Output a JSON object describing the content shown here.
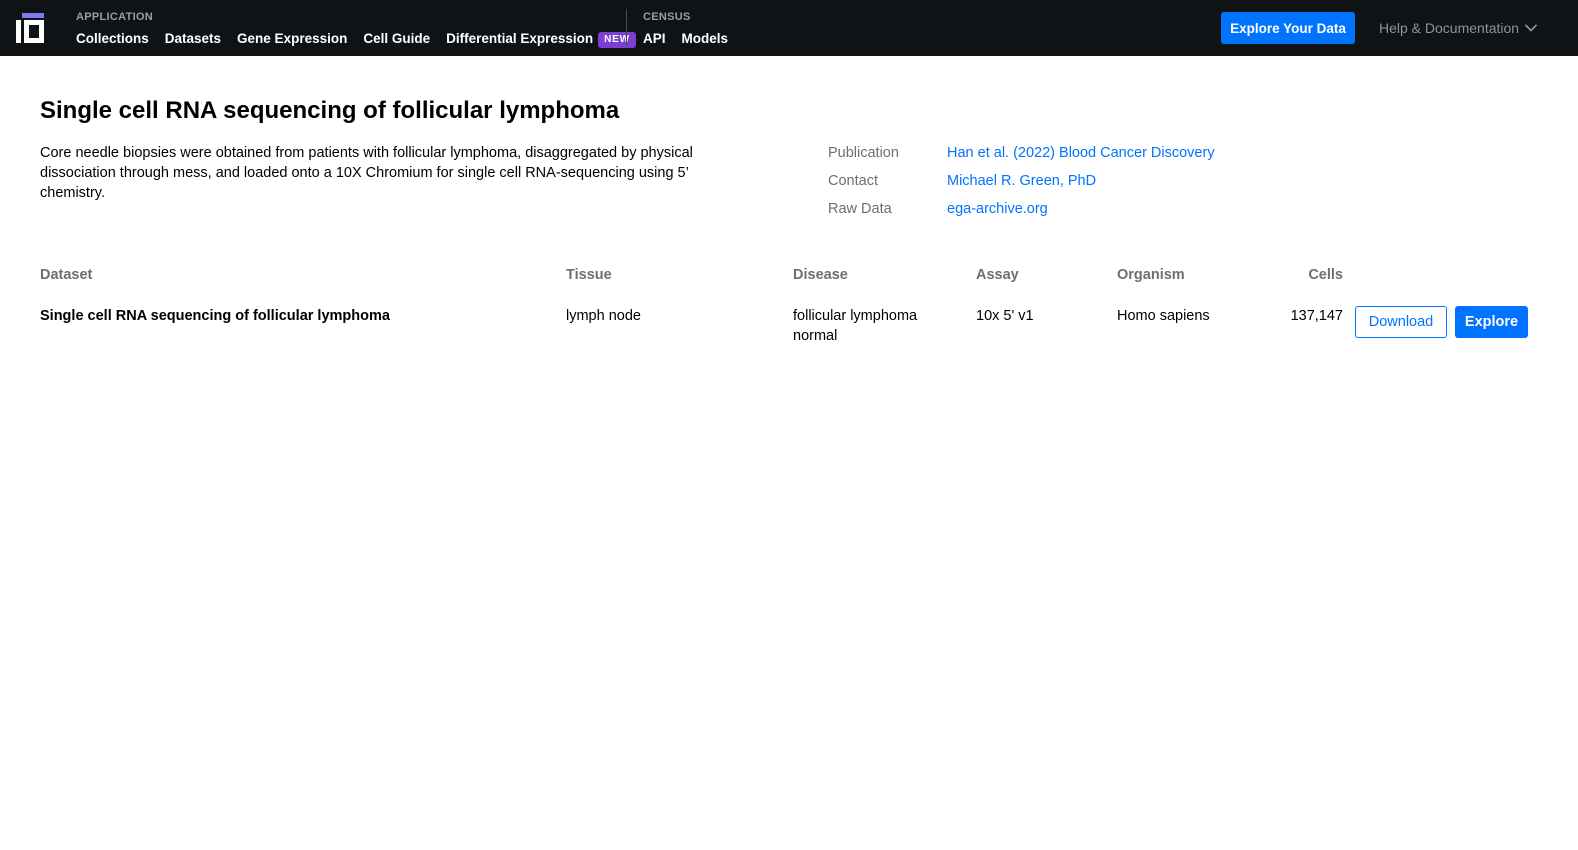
{
  "header": {
    "logo": {
      "icon": "cellxgene-logo-icon",
      "accent_color": "#7b7bf2"
    },
    "application": {
      "heading": "APPLICATION",
      "links": [
        "Collections",
        "Datasets",
        "Gene Expression",
        "Cell Guide",
        "Differential Expression"
      ],
      "badge": "NEW"
    },
    "census": {
      "heading": "CENSUS",
      "links": [
        "API",
        "Models"
      ]
    },
    "cta_label": "Explore Your Data",
    "help_label": "Help & Documentation",
    "help_icon": "chevron-down-icon"
  },
  "collection": {
    "title": "Single cell RNA sequencing of follicular lymphoma",
    "description": "Core needle biopsies were obtained from patients with follicular lymphoma, disaggregated by physical dissociation through mess, and loaded onto a 10X Chromium for single cell RNA-sequencing using 5’ chemistry.",
    "metadata": [
      {
        "label": "Publication",
        "value": "Han et al. (2022) Blood Cancer Discovery"
      },
      {
        "label": "Contact",
        "value": "Michael R. Green, PhD"
      },
      {
        "label": "Raw Data",
        "value": "ega-archive.org"
      }
    ]
  },
  "table": {
    "columns": [
      "Dataset",
      "Tissue",
      "Disease",
      "Assay",
      "Organism",
      "Cells"
    ],
    "rows": [
      {
        "dataset": "Single cell RNA sequencing of follicular lymphoma",
        "tissue": "lymph node",
        "disease": [
          "follicular lymphoma",
          "normal"
        ],
        "assay": "10x 5' v1",
        "organism": "Homo sapiens",
        "cells": "137,147",
        "download_label": "Download",
        "explore_label": "Explore"
      }
    ]
  },
  "colors": {
    "nav_background": "#101316",
    "primary": "#0073ff",
    "badge": "#7b3fd3",
    "muted_text": "#6c6f73"
  }
}
